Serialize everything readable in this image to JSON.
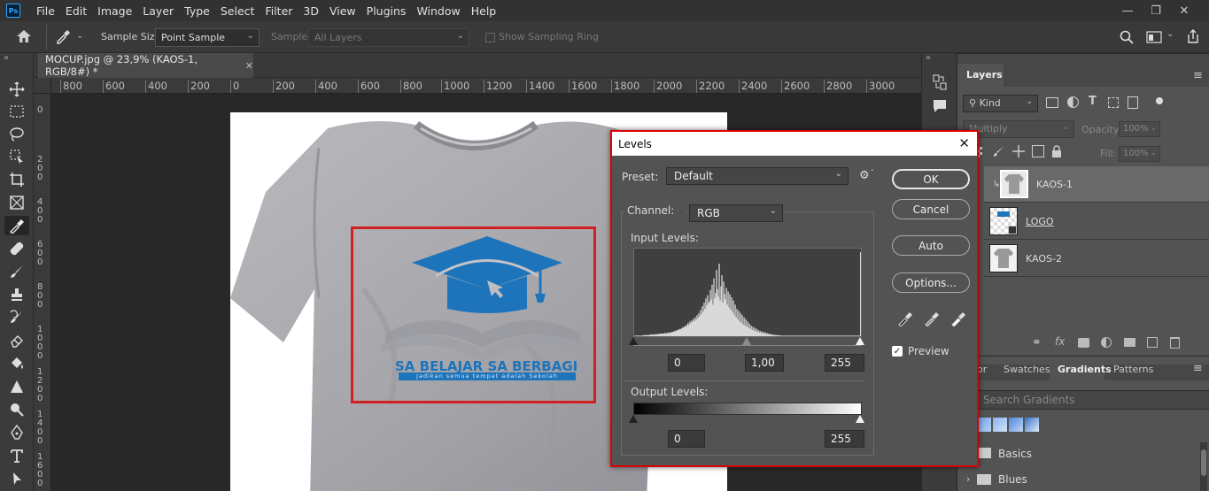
{
  "app": {
    "logo": "Ps"
  },
  "menu": [
    "File",
    "Edit",
    "Image",
    "Layer",
    "Type",
    "Select",
    "Filter",
    "3D",
    "View",
    "Plugins",
    "Window",
    "Help"
  ],
  "options": {
    "sample_size_label": "Sample Size:",
    "sample_size_value": "Point Sample",
    "sample_label": "Sample:",
    "sample_value": "All Layers",
    "sampling_ring_label": "Show Sampling Ring"
  },
  "document": {
    "tab_title": "MOCUP.jpg @ 23,9% (KAOS-1, RGB/8#) *"
  },
  "ruler": {
    "h": [
      "800",
      "600",
      "400",
      "200",
      "0",
      "200",
      "400",
      "600",
      "800",
      "1000",
      "1200",
      "1400",
      "1600",
      "1800",
      "2000",
      "2200",
      "2400",
      "2600",
      "2800",
      "3000"
    ],
    "v": [
      "0",
      "2\n0\n0",
      "4\n0\n0",
      "6\n0\n0",
      "8\n0\n0",
      "1\n0\n0\n0",
      "1\n2\n0\n0",
      "1\n4\n0\n0",
      "1\n6\n0\n0"
    ]
  },
  "artwork": {
    "logo_title": "SA BELAJAR SA BERBAGI",
    "logo_subtitle": "Jadikan semua tempat adalah Sekolah",
    "logo_color": "#1d74bb"
  },
  "layers_panel": {
    "tab": "Layers",
    "filter_kind": "Kind",
    "blend_mode": "Multiply",
    "opacity_label": "Opacity:",
    "opacity_value": "100%",
    "fill_label": "Fill:",
    "fill_value": "100%",
    "layers": [
      {
        "name": "KAOS-1",
        "selected": true
      },
      {
        "name": "LOGO",
        "selected": false
      },
      {
        "name": "KAOS-2",
        "selected": false
      }
    ]
  },
  "gradients_panel": {
    "tabs": [
      "or",
      "Swatches",
      "Gradients",
      "Patterns"
    ],
    "active_tab": "Gradients",
    "search_placeholder": "Search Gradients",
    "folders": [
      "Basics",
      "Blues"
    ]
  },
  "levels": {
    "title": "Levels",
    "preset_label": "Preset:",
    "preset_value": "Default",
    "channel_label": "Channel:",
    "channel_value": "RGB",
    "input_label": "Input Levels:",
    "input_black": "0",
    "input_gamma": "1,00",
    "input_white": "255",
    "output_label": "Output Levels:",
    "output_black": "0",
    "output_white": "255",
    "buttons": {
      "ok": "OK",
      "cancel": "Cancel",
      "auto": "Auto",
      "options": "Options..."
    },
    "preview_label": "Preview",
    "preview_checked": true
  },
  "chart_data": {
    "type": "bar",
    "title": "",
    "x_range": [
      0,
      255
    ],
    "values": [
      1,
      1,
      1,
      1,
      1,
      1,
      1,
      1,
      1,
      1,
      2,
      2,
      2,
      2,
      2,
      2,
      2,
      3,
      3,
      3,
      3,
      3,
      3,
      4,
      3,
      4,
      4,
      4,
      5,
      4,
      5,
      5,
      5,
      5,
      6,
      5,
      6,
      6,
      7,
      6,
      7,
      7,
      8,
      8,
      9,
      10,
      9,
      11,
      12,
      11,
      13,
      14,
      13,
      15,
      17,
      16,
      18,
      20,
      18,
      22,
      25,
      21,
      28,
      24,
      30,
      27,
      33,
      29,
      36,
      31,
      40,
      34,
      44,
      38,
      50,
      42,
      57,
      47,
      64,
      52,
      72,
      58,
      78,
      63,
      66,
      88,
      70,
      98,
      60,
      110,
      72,
      82,
      126,
      90,
      75,
      138,
      68,
      95,
      116,
      64,
      104,
      80,
      70,
      92,
      60,
      85,
      55,
      80,
      50,
      74,
      46,
      68,
      40,
      60,
      36,
      52,
      32,
      48,
      28,
      44,
      25,
      40,
      22,
      36,
      20,
      32,
      18,
      28,
      16,
      24,
      14,
      20,
      12,
      18,
      10,
      16,
      9,
      14,
      8,
      12,
      7,
      10,
      6,
      9,
      5,
      8,
      5,
      7,
      4,
      6,
      4,
      5,
      3,
      4,
      3,
      3,
      2,
      3,
      2,
      2,
      2,
      2,
      1,
      2,
      1,
      1,
      1,
      1,
      1,
      1,
      1,
      1,
      1,
      1,
      1,
      1,
      1,
      1,
      1,
      1,
      1,
      1,
      1,
      1,
      1,
      1,
      1,
      1,
      1,
      1,
      1,
      1,
      1,
      1,
      1,
      1,
      1,
      1,
      1,
      1,
      1,
      1,
      1,
      1,
      1,
      1,
      1,
      1,
      1,
      1,
      1,
      1,
      1,
      1,
      1,
      1,
      1,
      1,
      1,
      1,
      1,
      1,
      1,
      1,
      1,
      1,
      1,
      1,
      1,
      1,
      1,
      1,
      1,
      1,
      1,
      1,
      1,
      1,
      1,
      1,
      1,
      1,
      1,
      1,
      1,
      1,
      1,
      1,
      1,
      1,
      1,
      1,
      1,
      1,
      160
    ]
  }
}
